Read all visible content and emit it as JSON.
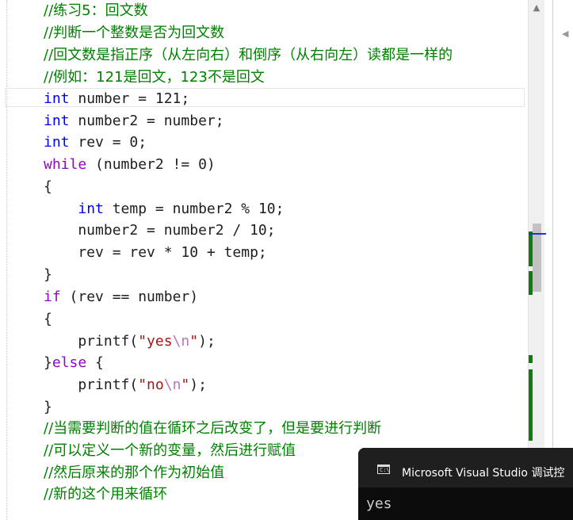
{
  "editor": {
    "lines": [
      {
        "tokens": [
          {
            "t": "//练习5：回文数",
            "c": "cm cjk"
          }
        ]
      },
      {
        "tokens": [
          {
            "t": "//判断一个整数是否为回文数",
            "c": "cm cjk"
          }
        ]
      },
      {
        "tokens": [
          {
            "t": "//回文数是指正序（从左向右）和倒序（从右向左）读都是一样的",
            "c": "cm cjk"
          }
        ]
      },
      {
        "tokens": [
          {
            "t": "//例如：121是回文，123不是回文",
            "c": "cm cjk"
          }
        ]
      },
      {
        "tokens": [
          {
            "t": "int",
            "c": "k"
          },
          {
            "t": " number = 121;",
            "c": ""
          }
        ]
      },
      {
        "tokens": [
          {
            "t": "int",
            "c": "k"
          },
          {
            "t": " number2 = number;",
            "c": ""
          }
        ]
      },
      {
        "tokens": [
          {
            "t": "int",
            "c": "k"
          },
          {
            "t": " rev = 0;",
            "c": ""
          }
        ]
      },
      {
        "tokens": [
          {
            "t": "while",
            "c": "kc"
          },
          {
            "t": " (number2 != 0)",
            "c": ""
          }
        ]
      },
      {
        "tokens": [
          {
            "t": "{",
            "c": ""
          }
        ]
      },
      {
        "tokens": [
          {
            "t": "    ",
            "c": ""
          },
          {
            "t": "int",
            "c": "k"
          },
          {
            "t": " temp = number2 % 10;",
            "c": ""
          }
        ]
      },
      {
        "tokens": [
          {
            "t": "    number2 = number2 / 10;",
            "c": ""
          }
        ]
      },
      {
        "tokens": [
          {
            "t": "    rev = rev * 10 + temp;",
            "c": ""
          }
        ]
      },
      {
        "tokens": [
          {
            "t": "}",
            "c": ""
          }
        ]
      },
      {
        "tokens": [
          {
            "t": "if",
            "c": "kc"
          },
          {
            "t": " (rev == number)",
            "c": ""
          }
        ]
      },
      {
        "tokens": [
          {
            "t": "{",
            "c": ""
          }
        ]
      },
      {
        "tokens": [
          {
            "t": "    printf(",
            "c": ""
          },
          {
            "t": "\"yes",
            "c": "s"
          },
          {
            "t": "\\n",
            "c": "esc"
          },
          {
            "t": "\"",
            "c": "s"
          },
          {
            "t": ");",
            "c": ""
          }
        ]
      },
      {
        "tokens": [
          {
            "t": "}",
            "c": ""
          },
          {
            "t": "else",
            "c": "kc"
          },
          {
            "t": " {",
            "c": ""
          }
        ]
      },
      {
        "tokens": [
          {
            "t": "    printf(",
            "c": ""
          },
          {
            "t": "\"no",
            "c": "s"
          },
          {
            "t": "\\n",
            "c": "esc"
          },
          {
            "t": "\"",
            "c": "s"
          },
          {
            "t": ");",
            "c": ""
          }
        ]
      },
      {
        "tokens": [
          {
            "t": "}",
            "c": ""
          }
        ]
      },
      {
        "tokens": [
          {
            "t": "//当需要判断的值在循环之后改变了，但是要进行判断",
            "c": "cm cjk"
          }
        ]
      },
      {
        "tokens": [
          {
            "t": "//可以定义一个新的变量，然后进行赋值",
            "c": "cm cjk"
          }
        ]
      },
      {
        "tokens": [
          {
            "t": "//然后原来的那个作为初始值",
            "c": "cm cjk"
          }
        ]
      },
      {
        "tokens": [
          {
            "t": "//新的这个用来循环",
            "c": "cm cjk"
          }
        ]
      }
    ]
  },
  "console": {
    "title": "Microsoft Visual Studio 调试控",
    "output": "yes"
  },
  "scroll_arrow_glyph": "▲",
  "pane_arrow_glyph": "◀"
}
